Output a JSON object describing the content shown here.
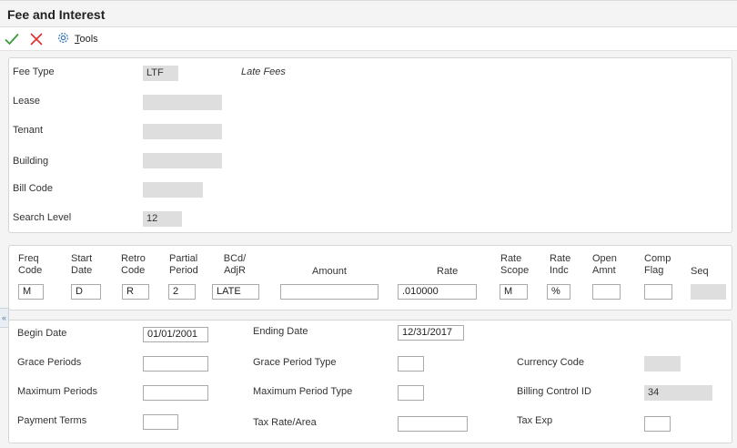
{
  "title": "Fee and Interest",
  "toolbar": {
    "ok_icon": "checkmark-icon",
    "cancel_icon": "x-icon",
    "tools_icon": "gear-icon",
    "tools_label": "Tools"
  },
  "header": {
    "fee_type_label": "Fee Type",
    "fee_type_value": "LTF",
    "fee_type_desc": "Late Fees",
    "lease_label": "Lease",
    "lease_value": "",
    "tenant_label": "Tenant",
    "tenant_value": "",
    "building_label": "Building",
    "building_value": "",
    "bill_code_label": "Bill Code",
    "bill_code_value": "",
    "search_level_label": "Search Level",
    "search_level_value": "12"
  },
  "grid": {
    "freq_code_label": "Freq\nCode",
    "freq_code_value": "M",
    "start_date_label": "Start\nDate",
    "start_date_value": "D",
    "retro_code_label": "Retro\nCode",
    "retro_code_value": "R",
    "partial_period_label": "Partial\nPeriod",
    "partial_period_value": "2",
    "bcd_label": "BCd/\nAdjR",
    "bcd_value": "LATE",
    "amount_label": "Amount",
    "amount_value": "",
    "rate_label": "Rate",
    "rate_value": ".010000",
    "rate_scope_label": "Rate\nScope",
    "rate_scope_value": "M",
    "rate_indc_label": "Rate\nIndc",
    "rate_indc_value": "%",
    "open_amnt_label": "Open\nAmnt",
    "open_amnt_value": "",
    "comp_flag_label": "Comp\nFlag",
    "comp_flag_value": "",
    "seq_label": "Seq",
    "seq_value": ""
  },
  "detail": {
    "begin_date_label": "Begin Date",
    "begin_date_value": "01/01/2001",
    "ending_date_label": "Ending Date",
    "ending_date_value": "12/31/2017",
    "grace_periods_label": "Grace Periods",
    "grace_periods_value": "",
    "grace_period_type_label": "Grace Period Type",
    "grace_period_type_value": "",
    "currency_code_label": "Currency Code",
    "currency_code_value": "",
    "maximum_periods_label": "Maximum Periods",
    "maximum_periods_value": "",
    "maximum_period_type_label": "Maximum Period Type",
    "maximum_period_type_value": "",
    "billing_control_id_label": "Billing Control ID",
    "billing_control_id_value": "34",
    "payment_terms_label": "Payment Terms",
    "payment_terms_value": "",
    "tax_rate_area_label": "Tax Rate/Area",
    "tax_rate_area_value": "",
    "tax_exp_label": "Tax Exp",
    "tax_exp_value": ""
  },
  "side_tab_glyph": "«"
}
